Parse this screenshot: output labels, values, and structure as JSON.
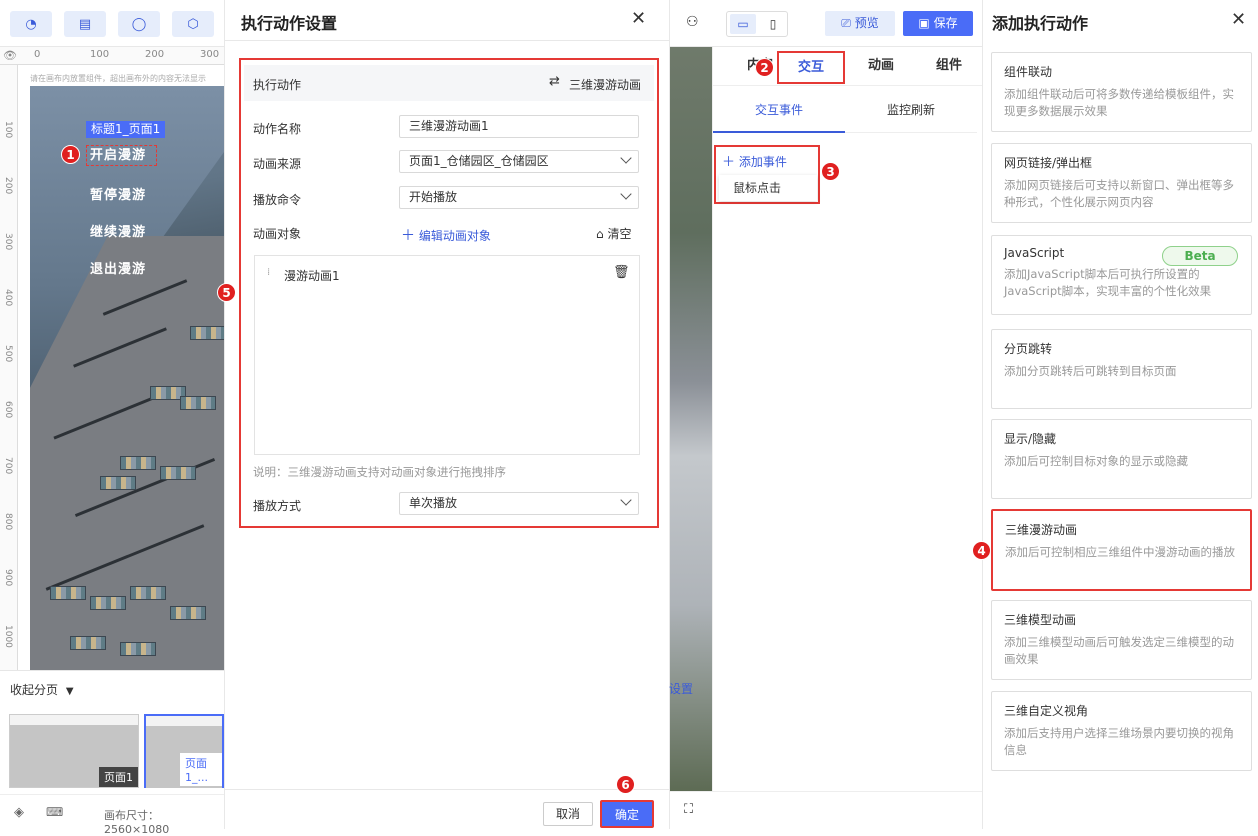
{
  "left": {
    "ruler_top": [
      "0",
      "100",
      "200",
      "300"
    ],
    "ruler_left": [
      "100",
      "200",
      "300",
      "400",
      "500",
      "600",
      "700",
      "800",
      "900",
      "1000"
    ],
    "canvas_hint": "请在画布内放置组件，超出画布外的内容无法显示",
    "canvas_title_tag": "标题1_页面1",
    "canvas_buttons": [
      "开启漫游",
      "暂停漫游",
      "继续漫游",
      "退出漫游"
    ],
    "pages_toggle": "收起分页",
    "thumbs": [
      "页面1",
      "页面1_..."
    ],
    "canvas_size": "画布尺寸：2560×1080"
  },
  "dialog": {
    "title": "执行动作设置",
    "section_label": "执行动作",
    "section_value": "三维漫游动画",
    "fields": {
      "name_label": "动作名称",
      "name_value": "三维漫游动画1",
      "source_label": "动画来源",
      "source_value": "页面1_仓储园区_仓储园区",
      "command_label": "播放命令",
      "command_value": "开始播放",
      "object_label": "动画对象",
      "edit_objects": "编辑动画对象",
      "clear": "清空",
      "object_item": "漫游动画1",
      "hint": "说明：三维漫游动画支持对动画对象进行拖拽排序",
      "mode_label": "播放方式",
      "mode_value": "单次播放"
    },
    "cancel": "取消",
    "confirm": "确定"
  },
  "toolbar": {
    "preview": "预览",
    "save": "保存"
  },
  "attr_panel": {
    "tabs": [
      "内容",
      "交互",
      "动画",
      "组件"
    ],
    "subtabs": [
      "交互事件",
      "监控刷新"
    ],
    "add_event": "添加事件",
    "event_option": "鼠标点击",
    "settings_label": "设置"
  },
  "actions_panel": {
    "title": "添加执行动作",
    "cards": [
      {
        "title": "组件联动",
        "desc": "添加组件联动后可将多数传递给模板组件，实现更多数据展示效果"
      },
      {
        "title": "网页链接/弹出框",
        "desc": "添加网页链接后可支持以新窗口、弹出框等多种形式，个性化展示网页内容"
      },
      {
        "title": "JavaScript",
        "desc": "添加JavaScript脚本后可执行所设置的JavaScript脚本，实现丰富的个性化效果",
        "badge": "Beta"
      },
      {
        "title": "分页跳转",
        "desc": "添加分页跳转后可跳转到目标页面"
      },
      {
        "title": "显示/隐藏",
        "desc": "添加后可控制目标对象的显示或隐藏"
      },
      {
        "title": "三维漫游动画",
        "desc": "添加后可控制相应三维组件中漫游动画的播放"
      },
      {
        "title": "三维模型动画",
        "desc": "添加三维模型动画后可触发选定三维模型的动画效果"
      },
      {
        "title": "三维自定义视角",
        "desc": "添加后支持用户选择三维场景内要切换的视角信息"
      }
    ]
  },
  "markers": [
    "1",
    "2",
    "3",
    "4",
    "5",
    "6"
  ],
  "colors": {
    "accent": "#4a6cf7",
    "highlight": "#e53935"
  }
}
